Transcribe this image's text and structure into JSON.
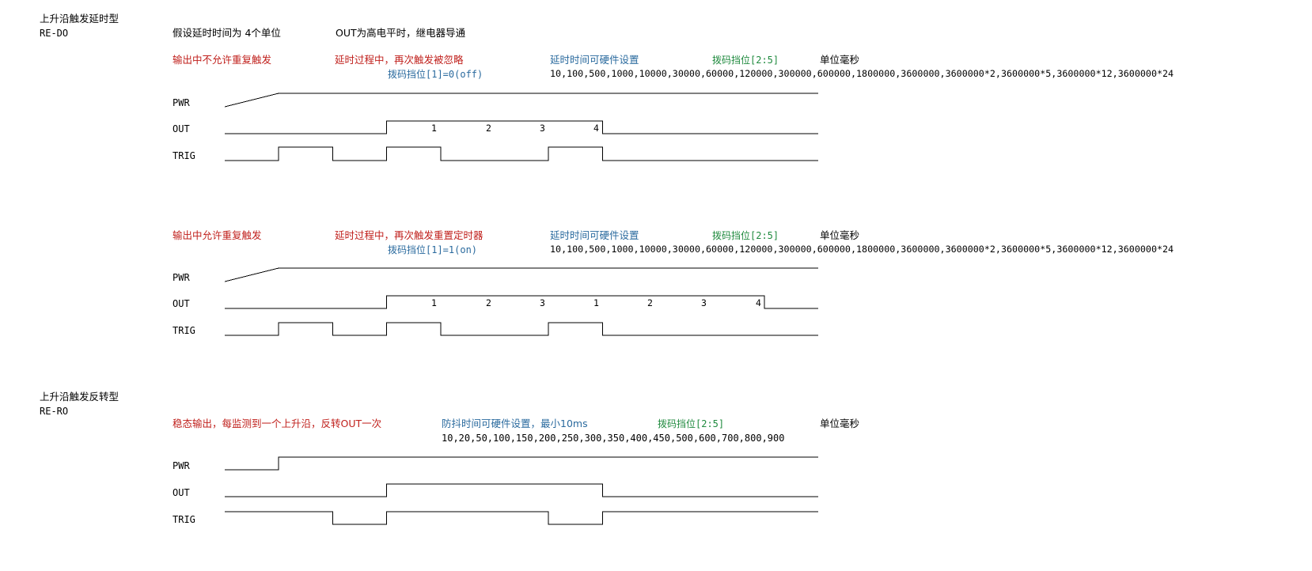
{
  "sec1": {
    "title": "上升沿触发延时型",
    "code": "RE-DO",
    "assume": "假设延时时间为 4个单位",
    "out_note": "OUT为高电平时，继电器导通",
    "d1": {
      "mode": "输出中不允许重复触发",
      "behavior": "延时过程中，再次触发被忽略",
      "dip1": "拨码挡位[1]=0(off)",
      "hw": "延时时间可硬件设置",
      "dip25": "拨码挡位[2:5]",
      "unit": "单位毫秒",
      "values": "10,100,500,1000,10000,30000,60000,120000,300000,600000,1800000,3600000,3600000*2,3600000*5,3600000*12,3600000*24",
      "pwr": "PWR",
      "out": "OUT",
      "trig": "TRIG",
      "counts": [
        "1",
        "2",
        "3",
        "4"
      ],
      "waves": {
        "pwr": [
          [
            0,
            0
          ],
          [
            1,
            1
          ],
          [
            11,
            1
          ]
        ],
        "out": [
          [
            0,
            0
          ],
          [
            3,
            0
          ],
          [
            3,
            1
          ],
          [
            7,
            1
          ],
          [
            7,
            0
          ],
          [
            11,
            0
          ]
        ],
        "trig": [
          [
            0,
            0
          ],
          [
            1,
            0
          ],
          [
            1,
            1
          ],
          [
            2,
            1
          ],
          [
            2,
            0
          ],
          [
            3,
            0
          ],
          [
            3,
            1
          ],
          [
            4,
            1
          ],
          [
            4,
            0
          ],
          [
            6,
            0
          ],
          [
            6,
            1
          ],
          [
            7,
            1
          ],
          [
            7,
            0
          ],
          [
            11,
            0
          ]
        ]
      }
    },
    "d2": {
      "mode": "输出中允许重复触发",
      "behavior": "延时过程中，再次触发重置定时器",
      "dip1": "拨码挡位[1]=1(on)",
      "hw": "延时时间可硬件设置",
      "dip25": "拨码挡位[2:5]",
      "unit": "单位毫秒",
      "values": "10,100,500,1000,10000,30000,60000,120000,300000,600000,1800000,3600000,3600000*2,3600000*5,3600000*12,3600000*24",
      "pwr": "PWR",
      "out": "OUT",
      "trig": "TRIG",
      "counts": [
        "1",
        "2",
        "3",
        "1",
        "2",
        "3",
        "4"
      ],
      "waves": {
        "pwr": [
          [
            0,
            0
          ],
          [
            1,
            1
          ],
          [
            11,
            1
          ]
        ],
        "out": [
          [
            0,
            0
          ],
          [
            3,
            0
          ],
          [
            3,
            1
          ],
          [
            10,
            1
          ],
          [
            10,
            0
          ],
          [
            11,
            0
          ]
        ],
        "trig": [
          [
            0,
            0
          ],
          [
            1,
            0
          ],
          [
            1,
            1
          ],
          [
            2,
            1
          ],
          [
            2,
            0
          ],
          [
            3,
            0
          ],
          [
            3,
            1
          ],
          [
            4,
            1
          ],
          [
            4,
            0
          ],
          [
            6,
            0
          ],
          [
            6,
            1
          ],
          [
            7,
            1
          ],
          [
            7,
            0
          ],
          [
            11,
            0
          ]
        ]
      }
    }
  },
  "sec2": {
    "title": "上升沿触发反转型",
    "code": "RE-RO",
    "d3": {
      "mode": "稳态输出，每监测到一个上升沿，反转OUT一次",
      "hw": "防抖时间可硬件设置，最小10ms",
      "dip25": "拨码挡位[2:5]",
      "unit": "单位毫秒",
      "values": "10,20,50,100,150,200,250,300,350,400,450,500,600,700,800,900",
      "pwr": "PWR",
      "out": "OUT",
      "trig": "TRIG",
      "waves": {
        "pwr": [
          [
            0,
            0
          ],
          [
            1,
            0
          ],
          [
            1,
            1
          ],
          [
            11,
            1
          ]
        ],
        "out": [
          [
            0,
            0
          ],
          [
            3,
            0
          ],
          [
            3,
            1
          ],
          [
            7,
            1
          ],
          [
            7,
            0
          ],
          [
            11,
            0
          ]
        ],
        "trig": [
          [
            0,
            1
          ],
          [
            2,
            1
          ],
          [
            2,
            0
          ],
          [
            3,
            0
          ],
          [
            3,
            1
          ],
          [
            6,
            1
          ],
          [
            6,
            0
          ],
          [
            7,
            0
          ],
          [
            7,
            1
          ],
          [
            11,
            1
          ]
        ]
      }
    }
  },
  "colors": {
    "red": "#c0201c",
    "blue": "#2a6a9e",
    "green": "#1f8a3e",
    "line": "#000000"
  }
}
